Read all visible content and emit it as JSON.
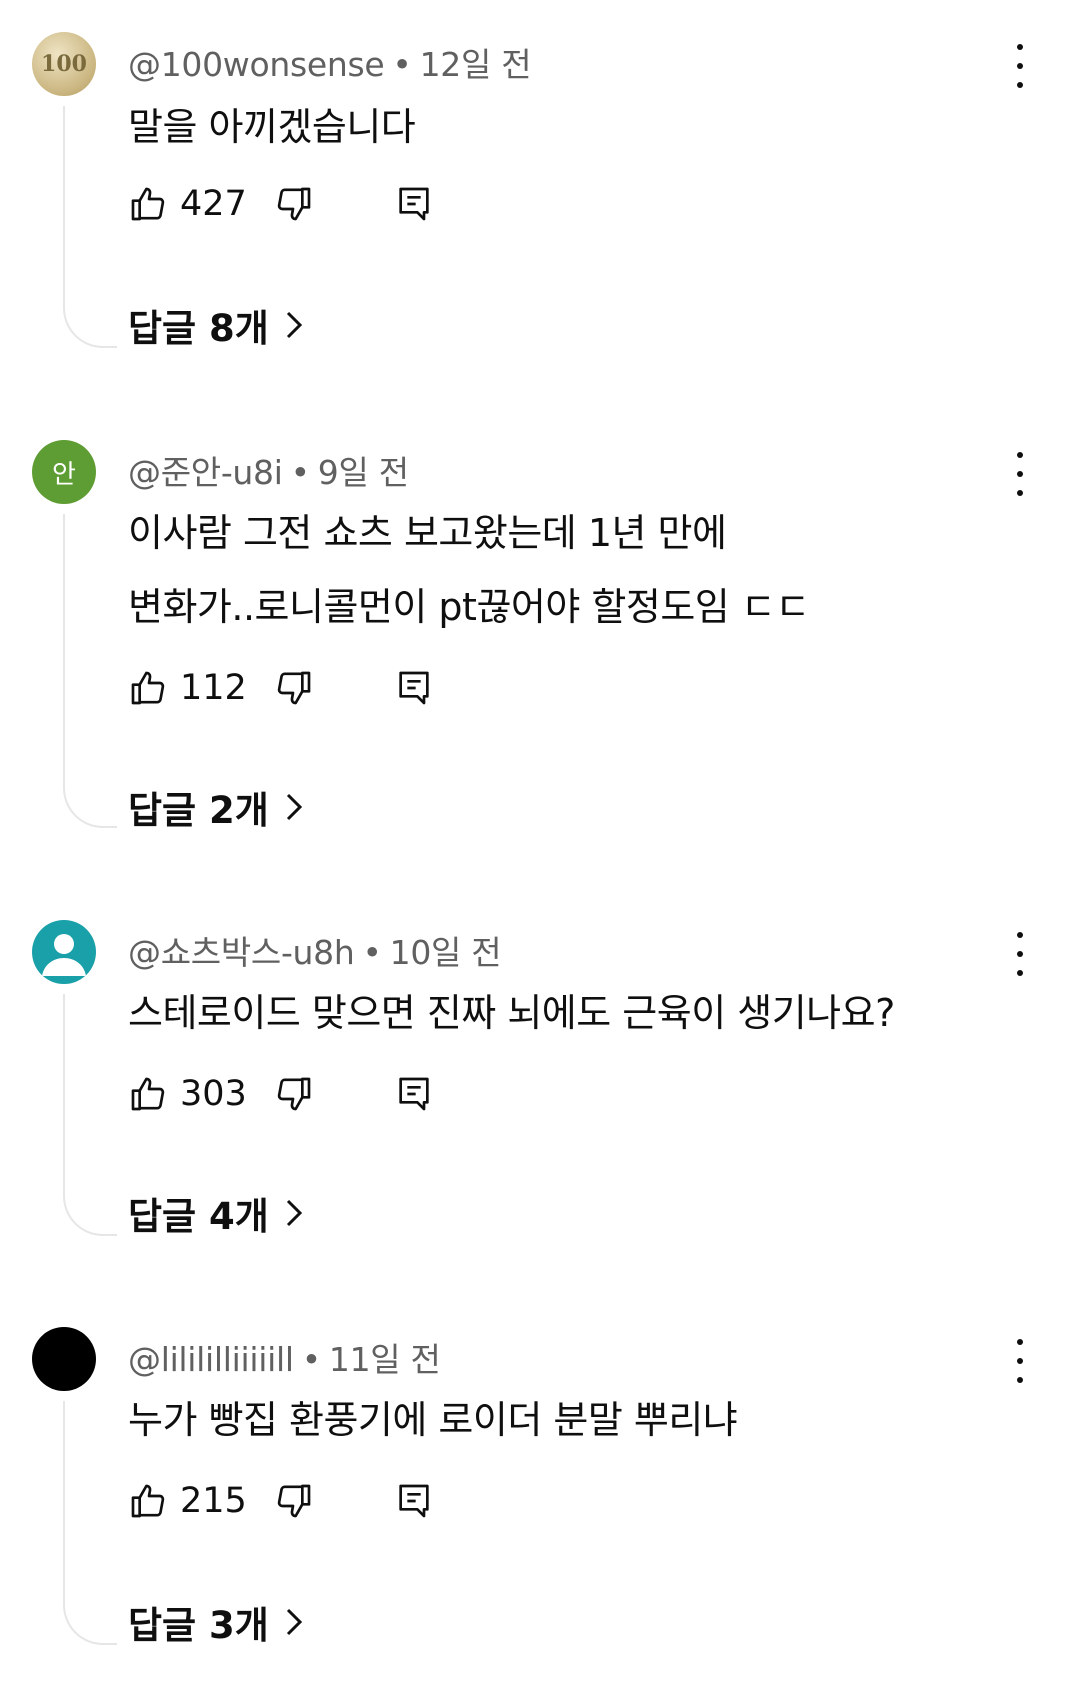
{
  "comments": [
    {
      "author": "@100wonsense",
      "time": "12일 전",
      "avatar": {
        "kind": "coin",
        "text": "100"
      },
      "lines": [
        "말을 아끼겠습니다"
      ],
      "likes": "427",
      "replies": "답글 8개"
    },
    {
      "author": "@준안-u8i",
      "time": "9일 전",
      "avatar": {
        "kind": "letter",
        "text": "안",
        "color": "#5e9d33"
      },
      "lines": [
        "이사람 그전 쇼츠 보고왔는데 1년 만에",
        "변화가..로니콜먼이 pt끊어야 할정도임 ㄷㄷ"
      ],
      "likes": "112",
      "replies": "답글 2개"
    },
    {
      "author": "@쇼츠박스-u8h",
      "time": "10일 전",
      "avatar": {
        "kind": "default",
        "color": "#1aa0a8"
      },
      "lines": [
        "스테로이드 맞으면 진짜 뇌에도 근육이 생기나요?"
      ],
      "likes": "303",
      "replies": "답글 4개"
    },
    {
      "author": "@lilililliiiiill",
      "time": "11일 전",
      "avatar": {
        "kind": "solid",
        "color": "#000000"
      },
      "lines": [
        "누가 빵집 환풍기에 로이더 분말 뿌리냐"
      ],
      "likes": "215",
      "replies": "답글 3개"
    }
  ],
  "icons": {
    "like": "thumbs-up-icon",
    "dislike": "thumbs-down-icon",
    "reply": "comment-icon",
    "more": "more-vert-icon",
    "chevron": "chevron-right-icon"
  }
}
